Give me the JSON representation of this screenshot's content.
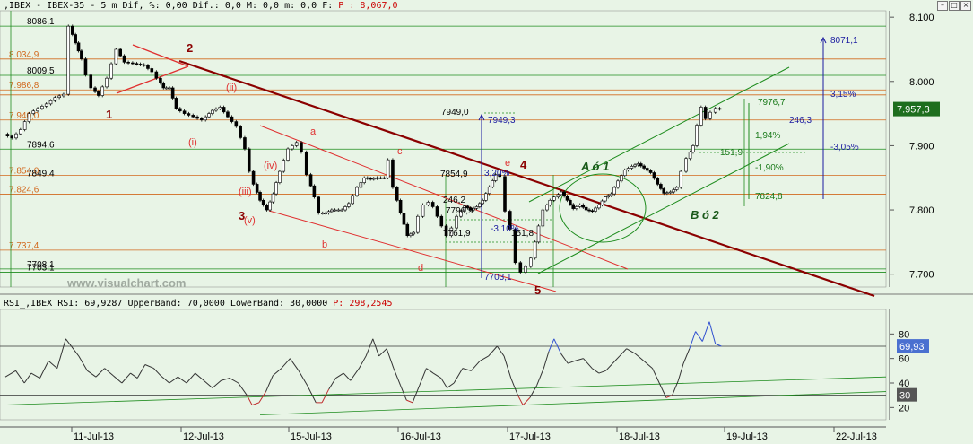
{
  "price_header": {
    "prefix": ",IBEX - IBEX-35 - 5 m Dif, %: 0,00 Dif.: 0,0 M: 0,0 m: 0,0 F:",
    "last_label": "P : 8,067,0"
  },
  "rsi_header": {
    "prefix": "RSI_,IBEX RSI: 69,9287 UpperBand: 70,0000 LowerBand: 30,0000",
    "last_label": "P: 298,2545"
  },
  "window_buttons": {
    "minimize": "–",
    "maximize": "□",
    "close": "×"
  },
  "watermark": "www.visualchart.com",
  "colors": {
    "background": "#e8f4e6",
    "grid_green": "#1e8c1e",
    "fib_orange": "#d2691e",
    "bear_trend": "#8b0000",
    "red_channel": "#e03030",
    "blue_proj": "#1a1aa0",
    "price_badge": "#1e6e1e",
    "rsi_line": "#333333",
    "rsi_over": "#3050d0",
    "rsi_under": "#c03030"
  },
  "price_badge": "7.957,3",
  "rsi_badges": {
    "rsi": "69,93",
    "lower": "30"
  },
  "chart_data": [
    {
      "type": "candlestick",
      "ylim": [
        7680,
        8110
      ],
      "y_ticks": [
        {
          "v": 8100,
          "label": "8.100"
        },
        {
          "v": 8000,
          "label": "8.000"
        },
        {
          "v": 7900,
          "label": "7.900"
        },
        {
          "v": 7800,
          "label": "7.800"
        },
        {
          "v": 7700,
          "label": "7.700"
        }
      ],
      "x_ticks": [
        "11-Jul-13",
        "12-Jul-13",
        "15-Jul-13",
        "16-Jul-13",
        "17-Jul-13",
        "18-Jul-13",
        "19-Jul-13",
        "22-Jul-13"
      ],
      "price_path": [
        [
          0,
          7918
        ],
        [
          1,
          7912
        ],
        [
          2,
          7925
        ],
        [
          3,
          7950
        ],
        [
          4,
          7958
        ],
        [
          5,
          7965
        ],
        [
          6,
          7975
        ],
        [
          7,
          7980
        ],
        [
          7.6,
          8086
        ],
        [
          8.3,
          8060
        ],
        [
          9.0,
          8035
        ],
        [
          9.6,
          8010
        ],
        [
          10.2,
          7990
        ],
        [
          11.0,
          7978
        ],
        [
          12.0,
          8005
        ],
        [
          13.1,
          8050
        ],
        [
          14.0,
          8030
        ],
        [
          15.0,
          8028
        ],
        [
          16.3,
          8025
        ],
        [
          17.2,
          8015
        ],
        [
          17.8,
          8005
        ],
        [
          18.5,
          7990
        ],
        [
          19.2,
          7990
        ],
        [
          20.0,
          7958
        ],
        [
          21.0,
          7950
        ],
        [
          22.0,
          7945
        ],
        [
          23.0,
          7940
        ],
        [
          24.2,
          7955
        ],
        [
          25.1,
          7960
        ],
        [
          26.0,
          7945
        ],
        [
          27.0,
          7930
        ],
        [
          28.0,
          7895
        ],
        [
          28.5,
          7860
        ],
        [
          29.0,
          7840
        ],
        [
          29.7,
          7815
        ],
        [
          30.5,
          7800
        ],
        [
          31.2,
          7825
        ],
        [
          32.0,
          7860
        ],
        [
          33.0,
          7895
        ],
        [
          34.0,
          7905
        ],
        [
          34.6,
          7890
        ],
        [
          35.2,
          7855
        ],
        [
          36.0,
          7820
        ],
        [
          36.6,
          7795
        ],
        [
          37.3,
          7795
        ],
        [
          38.0,
          7800
        ],
        [
          39.2,
          7800
        ],
        [
          40.0,
          7810
        ],
        [
          41.0,
          7835
        ],
        [
          41.8,
          7850
        ],
        [
          42.5,
          7848
        ],
        [
          43.3,
          7850
        ],
        [
          44.1,
          7850
        ],
        [
          44.6,
          7878
        ],
        [
          45.2,
          7835
        ],
        [
          46.0,
          7795
        ],
        [
          46.8,
          7760
        ],
        [
          47.5,
          7765
        ],
        [
          48.1,
          7790
        ],
        [
          48.7,
          7808
        ],
        [
          49.3,
          7812
        ],
        [
          49.8,
          7805
        ],
        [
          50.3,
          7790
        ],
        [
          50.8,
          7775
        ],
        [
          51.4,
          7760
        ],
        [
          52.0,
          7772
        ],
        [
          52.6,
          7790
        ],
        [
          53.4,
          7806
        ],
        [
          54.1,
          7800
        ],
        [
          54.8,
          7805
        ],
        [
          55.5,
          7815
        ],
        [
          56.3,
          7836
        ],
        [
          57.0,
          7855
        ],
        [
          57.6,
          7852
        ],
        [
          58.2,
          7798
        ],
        [
          58.8,
          7770
        ],
        [
          59.4,
          7718
        ],
        [
          60.0,
          7703
        ],
        [
          60.6,
          7712
        ],
        [
          61.2,
          7725
        ],
        [
          62.0,
          7775
        ],
        [
          62.6,
          7800
        ],
        [
          63.3,
          7815
        ],
        [
          63.9,
          7820
        ],
        [
          64.6,
          7828
        ],
        [
          65.3,
          7815
        ],
        [
          66.0,
          7802
        ],
        [
          66.8,
          7808
        ],
        [
          67.5,
          7800
        ],
        [
          68.2,
          7798
        ],
        [
          69.0,
          7808
        ],
        [
          69.7,
          7820
        ],
        [
          70.4,
          7825
        ],
        [
          71.2,
          7845
        ],
        [
          72.0,
          7862
        ],
        [
          72.8,
          7868
        ],
        [
          73.5,
          7872
        ],
        [
          74.2,
          7865
        ],
        [
          75.0,
          7858
        ],
        [
          75.8,
          7840
        ],
        [
          76.5,
          7826
        ],
        [
          77.3,
          7828
        ],
        [
          78.0,
          7835
        ],
        [
          78.6,
          7860
        ],
        [
          79.2,
          7880
        ],
        [
          79.9,
          7900
        ],
        [
          80.4,
          7932
        ],
        [
          80.9,
          7960
        ],
        [
          81.4,
          7942
        ],
        [
          82.0,
          7952
        ],
        [
          82.6,
          7958
        ],
        [
          83.0,
          7957
        ]
      ],
      "horizontal_levels": [
        {
          "value": 8086.1,
          "label": "8086,1",
          "color": "green"
        },
        {
          "value": 8034.9,
          "label": "8.034,9",
          "color": "orange"
        },
        {
          "value": 8009.5,
          "label": "8009,5",
          "color": "green"
        },
        {
          "value": 7986.8,
          "label": "7.986,8",
          "color": "orange"
        },
        {
          "value": 7979.0,
          "label": "",
          "color": "orange"
        },
        {
          "value": 7940.0,
          "label": "7.940,0",
          "color": "orange"
        },
        {
          "value": 7894.6,
          "label": "7894,6",
          "color": "green"
        },
        {
          "value": 7854.0,
          "label": "7.854,0",
          "color": "orange"
        },
        {
          "value": 7849.4,
          "label": "7849,4",
          "color": "green"
        },
        {
          "value": 7824.6,
          "label": "7.824,6",
          "color": "orange"
        },
        {
          "value": 7737.4,
          "label": "7.737,4",
          "color": "orange"
        },
        {
          "value": 7708.1,
          "label": "7708,1",
          "color": "green"
        },
        {
          "value": 7703.1,
          "label": "7703,1",
          "color": "green"
        }
      ],
      "annotations": {
        "wave_labels_dark": [
          "1",
          "2",
          "3",
          "4",
          "5",
          "A ó 1",
          "B ó 2"
        ],
        "wave_labels_red": [
          "(i)",
          "(ii)",
          "(iii)",
          "(iv)",
          "(v)",
          "a",
          "b",
          "c",
          "d",
          "e"
        ],
        "projection_texts": [
          "8071,1",
          "7949,0",
          "7949,3",
          "7854,9",
          "3,20%",
          "246,2",
          "7796,9",
          "7761,9",
          "-3,10%",
          "151,8",
          "7703,1",
          "7976,7",
          "1,94%",
          "-1,90%",
          "151,9",
          "7824,8",
          "3,15%",
          "-3,05%",
          "246,3"
        ]
      }
    },
    {
      "type": "line",
      "title": "RSI",
      "ylim": [
        10,
        100
      ],
      "y_ticks": [
        20,
        40,
        60,
        80
      ],
      "upper_band": 70,
      "lower_band": 30,
      "rsi_path": [
        [
          0,
          45
        ],
        [
          1.2,
          50
        ],
        [
          2.2,
          40
        ],
        [
          3.0,
          48
        ],
        [
          4.0,
          44
        ],
        [
          5.0,
          58
        ],
        [
          6.0,
          52
        ],
        [
          7.0,
          76
        ],
        [
          8.5,
          62
        ],
        [
          9.5,
          50
        ],
        [
          10.5,
          45
        ],
        [
          11.5,
          52
        ],
        [
          12.5,
          46
        ],
        [
          13.5,
          40
        ],
        [
          14.5,
          48
        ],
        [
          15.3,
          44
        ],
        [
          16.2,
          55
        ],
        [
          17.2,
          52
        ],
        [
          18.0,
          46
        ],
        [
          19.0,
          40
        ],
        [
          20.0,
          45
        ],
        [
          21.0,
          40
        ],
        [
          22.0,
          48
        ],
        [
          23.0,
          42
        ],
        [
          24.0,
          36
        ],
        [
          25.0,
          42
        ],
        [
          26.0,
          44
        ],
        [
          27.0,
          40
        ],
        [
          28.0,
          30
        ],
        [
          28.6,
          22
        ],
        [
          29.4,
          24
        ],
        [
          30.2,
          33
        ],
        [
          31.0,
          46
        ],
        [
          32.0,
          52
        ],
        [
          33.0,
          60
        ],
        [
          34.0,
          50
        ],
        [
          35.0,
          38
        ],
        [
          36.0,
          24
        ],
        [
          36.7,
          24
        ],
        [
          37.5,
          35
        ],
        [
          38.3,
          44
        ],
        [
          39.2,
          48
        ],
        [
          40.0,
          42
        ],
        [
          41.0,
          52
        ],
        [
          41.8,
          62
        ],
        [
          42.6,
          76
        ],
        [
          43.3,
          62
        ],
        [
          44.2,
          68
        ],
        [
          45.0,
          52
        ],
        [
          45.8,
          38
        ],
        [
          46.5,
          26
        ],
        [
          47.2,
          24
        ],
        [
          48.0,
          38
        ],
        [
          48.8,
          52
        ],
        [
          49.6,
          48
        ],
        [
          50.5,
          44
        ],
        [
          51.2,
          36
        ],
        [
          52.0,
          40
        ],
        [
          53.0,
          52
        ],
        [
          54.0,
          50
        ],
        [
          55.0,
          58
        ],
        [
          56.0,
          62
        ],
        [
          57.0,
          70
        ],
        [
          57.8,
          62
        ],
        [
          58.6,
          44
        ],
        [
          59.4,
          30
        ],
        [
          60.0,
          22
        ],
        [
          60.8,
          28
        ],
        [
          61.6,
          38
        ],
        [
          62.4,
          52
        ],
        [
          63.0,
          66
        ],
        [
          63.6,
          76
        ],
        [
          64.4,
          64
        ],
        [
          65.2,
          56
        ],
        [
          66.0,
          58
        ],
        [
          67.0,
          60
        ],
        [
          68.0,
          52
        ],
        [
          68.8,
          48
        ],
        [
          69.6,
          50
        ],
        [
          70.4,
          56
        ],
        [
          71.2,
          62
        ],
        [
          72.0,
          68
        ],
        [
          73.0,
          64
        ],
        [
          74.0,
          58
        ],
        [
          75.0,
          52
        ],
        [
          75.8,
          40
        ],
        [
          76.6,
          28
        ],
        [
          77.3,
          30
        ],
        [
          78.0,
          42
        ],
        [
          78.6,
          56
        ],
        [
          79.3,
          68
        ],
        [
          80.0,
          82
        ],
        [
          80.8,
          74
        ],
        [
          81.6,
          90
        ],
        [
          82.3,
          72
        ],
        [
          83.0,
          70
        ]
      ]
    }
  ]
}
